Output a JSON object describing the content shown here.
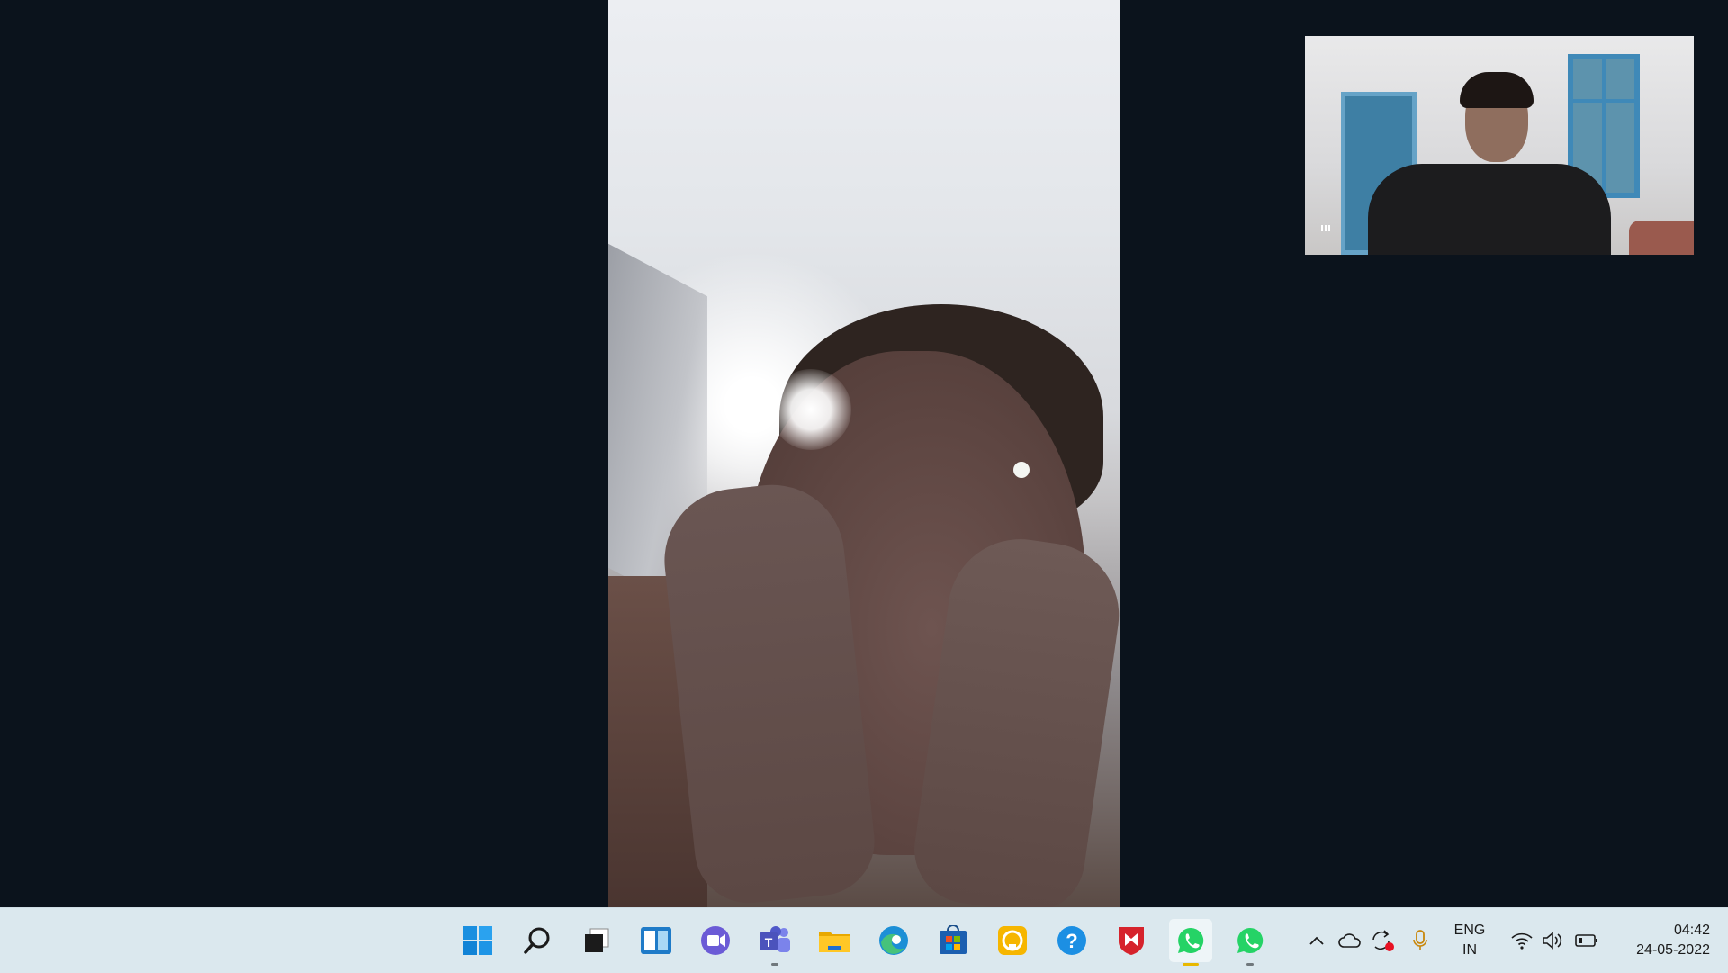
{
  "call": {
    "remote_video": {
      "kind": "remote-participant-video"
    },
    "self_preview": {
      "kind": "self-camera-preview"
    }
  },
  "taskbar": {
    "pinned": [
      {
        "name": "start",
        "icon": "windows-logo-icon"
      },
      {
        "name": "search",
        "icon": "search-icon"
      },
      {
        "name": "task-view",
        "icon": "task-view-icon"
      },
      {
        "name": "widgets",
        "icon": "widgets-icon"
      },
      {
        "name": "chat",
        "icon": "chat-camera-icon"
      },
      {
        "name": "teams",
        "icon": "teams-icon"
      },
      {
        "name": "file-explorer",
        "icon": "folder-icon"
      },
      {
        "name": "edge",
        "icon": "edge-icon"
      },
      {
        "name": "store",
        "icon": "store-icon"
      },
      {
        "name": "app-yellow",
        "icon": "yellow-badge-icon"
      },
      {
        "name": "get-help",
        "icon": "help-icon"
      },
      {
        "name": "mcafee",
        "icon": "shield-m-icon"
      },
      {
        "name": "whatsapp-active",
        "icon": "whatsapp-icon"
      },
      {
        "name": "whatsapp",
        "icon": "whatsapp-icon"
      }
    ],
    "tray": {
      "language_line1": "ENG",
      "language_line2": "IN",
      "time": "04:42",
      "date": "24-05-2022"
    }
  },
  "colors": {
    "background": "#0b131c",
    "taskbar": "#dbe8ee",
    "whatsapp": "#25d366",
    "active_indicator": "#e8b800"
  }
}
